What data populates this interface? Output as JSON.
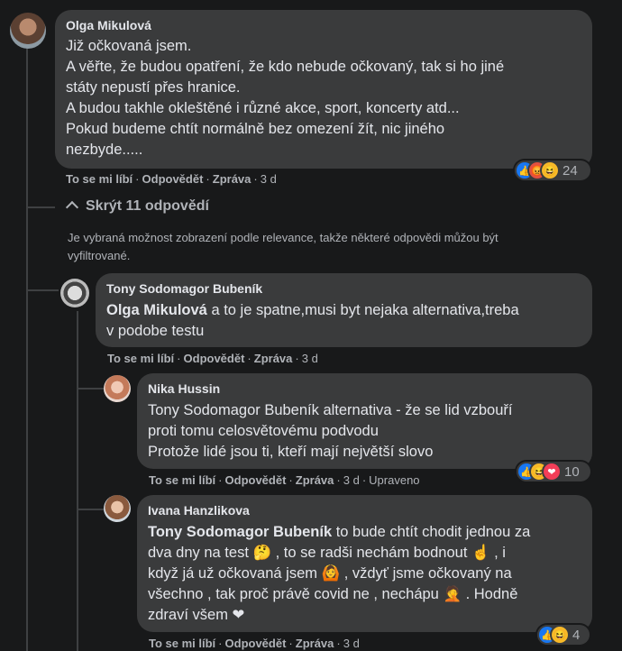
{
  "comment1": {
    "author": "Olga Mikulová",
    "lines": [
      "Již očkovaná jsem.",
      "A věřte, že budou opatření, že kdo nebude očkovaný, tak si ho jiné",
      "státy nepustí přes hranice.",
      "A budou takhle okleštěné i různé akce, sport, koncerty atd...",
      "Pokud budeme chtít normálně bez omezení žít, nic jiného",
      "nezbyde....."
    ],
    "like": "To se mi líbí",
    "reply": "Odpovědět",
    "message": "Zpráva",
    "time": "3 d",
    "reaction_count": "24"
  },
  "hide_replies": "Skrýt 11 odpovědí",
  "relevance_note": [
    "Je vybraná možnost zobrazení podle relevance, takže některé odpovědi můžou být",
    "vyfiltrované."
  ],
  "comment2": {
    "author": "Tony Sodomagor Bubeník",
    "mention": "Olga Mikulová",
    "line1_rest": " a to je spatne,musi byt nejaka alternativa,treba",
    "line2": "v podobe testu",
    "like": "To se mi líbí",
    "reply": "Odpovědět",
    "message": "Zpráva",
    "time": "3 d"
  },
  "comment3": {
    "author": "Nika Hussin",
    "lines": [
      "Tony Sodomagor Bubeník alternativa - že se lid vzbouří",
      "proti tomu celosvětovému podvodu",
      "Protože lidé jsou ti, kteří mají největší slovo"
    ],
    "like": "To se mi líbí",
    "reply": "Odpovědět",
    "message": "Zpráva",
    "time": "3 d",
    "edited": "Upraveno",
    "reaction_count": "10"
  },
  "comment4": {
    "author": "Ivana Hanzlikova",
    "mention": "Tony Sodomagor Bubeník",
    "line1_rest": " to bude chtít chodit jednou za",
    "line2": "dva dny na test 🤔 , to se radši nechám bodnout ☝ , i",
    "line3": "když já už očkovaná jsem 🙆 , vždyť jsme očkovaný na",
    "line4": "všechno , tak proč právě covid ne , nechápu 🤦 . Hodně",
    "line5": "zdraví všem ❤",
    "like": "To se mi líbí",
    "reply": "Odpovědět",
    "message": "Zpráva",
    "time": "3 d",
    "reaction_count": "4"
  }
}
